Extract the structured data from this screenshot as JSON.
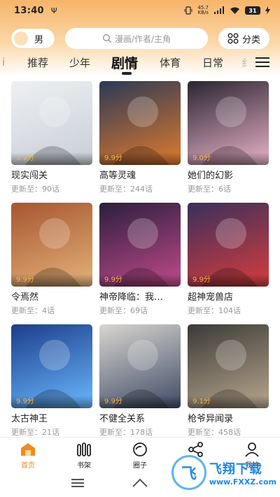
{
  "status_bar": {
    "time": "13:40",
    "net_speed_top": "45.7",
    "net_speed_bottom": "KB/s",
    "battery": "31"
  },
  "header": {
    "gender_label": "男",
    "search_placeholder": "漫画/作者/主角",
    "category_label": "分类"
  },
  "tabs": [
    {
      "label": "i"
    },
    {
      "label": "推荐"
    },
    {
      "label": "少年"
    },
    {
      "label": "剧情",
      "active": true
    },
    {
      "label": "体育"
    },
    {
      "label": "日常"
    },
    {
      "label": "纟"
    }
  ],
  "comics": [
    {
      "title": "现实闯关",
      "score": "9.9分",
      "update": "更新至：90话",
      "colors": [
        "#eef0f2",
        "#c9ced6"
      ]
    },
    {
      "title": "高等灵魂",
      "score": "9.9分",
      "update": "更新至：244话",
      "colors": [
        "#2b3a55",
        "#e07a2e"
      ]
    },
    {
      "title": "她们的幻影",
      "score": "9.0分",
      "update": "更新至：6话",
      "colors": [
        "#2a2430",
        "#e9b3c8"
      ]
    },
    {
      "title": "令焉然",
      "score": "9.9分",
      "update": "更新至：4话",
      "colors": [
        "#a7562f",
        "#e3b27a"
      ]
    },
    {
      "title": "神帝降临：我…",
      "score": "9.9分",
      "update": "更新至：69话",
      "colors": [
        "#2b1f3d",
        "#c04a8a"
      ]
    },
    {
      "title": "超神宠兽店",
      "score": "9.9分",
      "update": "更新至：104话",
      "colors": [
        "#3a2f5c",
        "#d63d3d"
      ]
    },
    {
      "title": "太古神王",
      "score": "9.9分",
      "update": "更新至：21话",
      "colors": [
        "#1c3e8a",
        "#6ab7ff"
      ]
    },
    {
      "title": "不健全关系",
      "score": "9.9分",
      "update": "更新至：178话",
      "colors": [
        "#d9d6d0",
        "#3f4a66"
      ]
    },
    {
      "title": "枪爷异闻录",
      "score": "9.1分",
      "update": "更新至：458话",
      "colors": [
        "#3b3a37",
        "#b8a78d"
      ]
    }
  ],
  "bottom_nav": [
    {
      "label": "首页",
      "icon": "home-icon",
      "active": true
    },
    {
      "label": "书架",
      "icon": "bookshelf-icon"
    },
    {
      "label": "圈子",
      "icon": "circle-icon"
    },
    {
      "label": "推广",
      "icon": "share-icon"
    },
    {
      "label": "我的",
      "icon": "profile-icon"
    }
  ],
  "watermark": {
    "logo_text": "飞",
    "name": "飞翔下载",
    "url": "www.FXXZ.com"
  },
  "colors": {
    "accent": "#f08c1a",
    "score": "#f5b447",
    "header_gradient_top": "#f7b469"
  }
}
